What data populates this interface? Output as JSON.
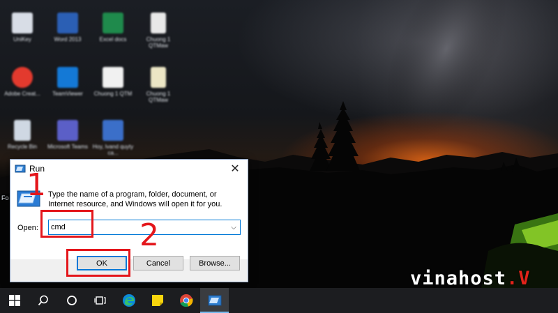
{
  "desktop": {
    "icons": [
      {
        "name": "unikey-icon",
        "label": "UniKey",
        "color": "#d8dde6"
      },
      {
        "name": "word-icon",
        "label": "Word 2013",
        "color": "#2b5fb4"
      },
      {
        "name": "excel-icon",
        "label": "Excel docs",
        "color": "#1f8a4c"
      },
      {
        "name": "file-icon",
        "label": "Chuong 1 QTMaw",
        "color": "#e8e8e8"
      },
      {
        "name": "adobe-icon",
        "label": "Adobe Creat...",
        "color": "#e33a2e"
      },
      {
        "name": "teamviewer-icon",
        "label": "TeamViewer",
        "color": "#1479d6"
      },
      {
        "name": "document-icon",
        "label": "Chuong 1 QTM",
        "color": "#f1f1f1"
      },
      {
        "name": "file-icon-2",
        "label": "Chuong 1 QTMaw",
        "color": "#ece6c5"
      },
      {
        "name": "recycle-bin-icon",
        "label": "Recycle Bin",
        "color": "#cfd8e3"
      },
      {
        "name": "teams-icon",
        "label": "Microsoft Teams",
        "color": "#5b5fc7"
      },
      {
        "name": "word-doc-icon",
        "label": "Hoy, lvand quyty ca...",
        "color": "#3b6fc9"
      }
    ],
    "partial_label": "Fo"
  },
  "run_dialog": {
    "title": "Run",
    "description": "Type the name of a program, folder, document, or Internet resource, and Windows will open it for you.",
    "open_label": "Open:",
    "input_value": "cmd",
    "ok_label": "OK",
    "cancel_label": "Cancel",
    "browse_label": "Browse..."
  },
  "annotations": {
    "step_1": "1",
    "step_2": "2",
    "highlight_color": "#e4161b"
  },
  "watermark": {
    "text": "vinahost",
    "mark": ".V"
  },
  "taskbar": {
    "items": [
      {
        "name": "start-button",
        "icon": "windows-logo-icon"
      },
      {
        "name": "search-button",
        "icon": "search-icon"
      },
      {
        "name": "cortana-button",
        "icon": "circle-icon"
      },
      {
        "name": "task-view-button",
        "icon": "task-view-icon"
      },
      {
        "name": "edge-button",
        "icon": "edge-icon"
      },
      {
        "name": "sticky-notes-button",
        "icon": "sticky-notes-icon"
      },
      {
        "name": "chrome-button",
        "icon": "chrome-icon"
      },
      {
        "name": "run-taskbar-button",
        "icon": "run-icon",
        "active": true
      }
    ]
  }
}
